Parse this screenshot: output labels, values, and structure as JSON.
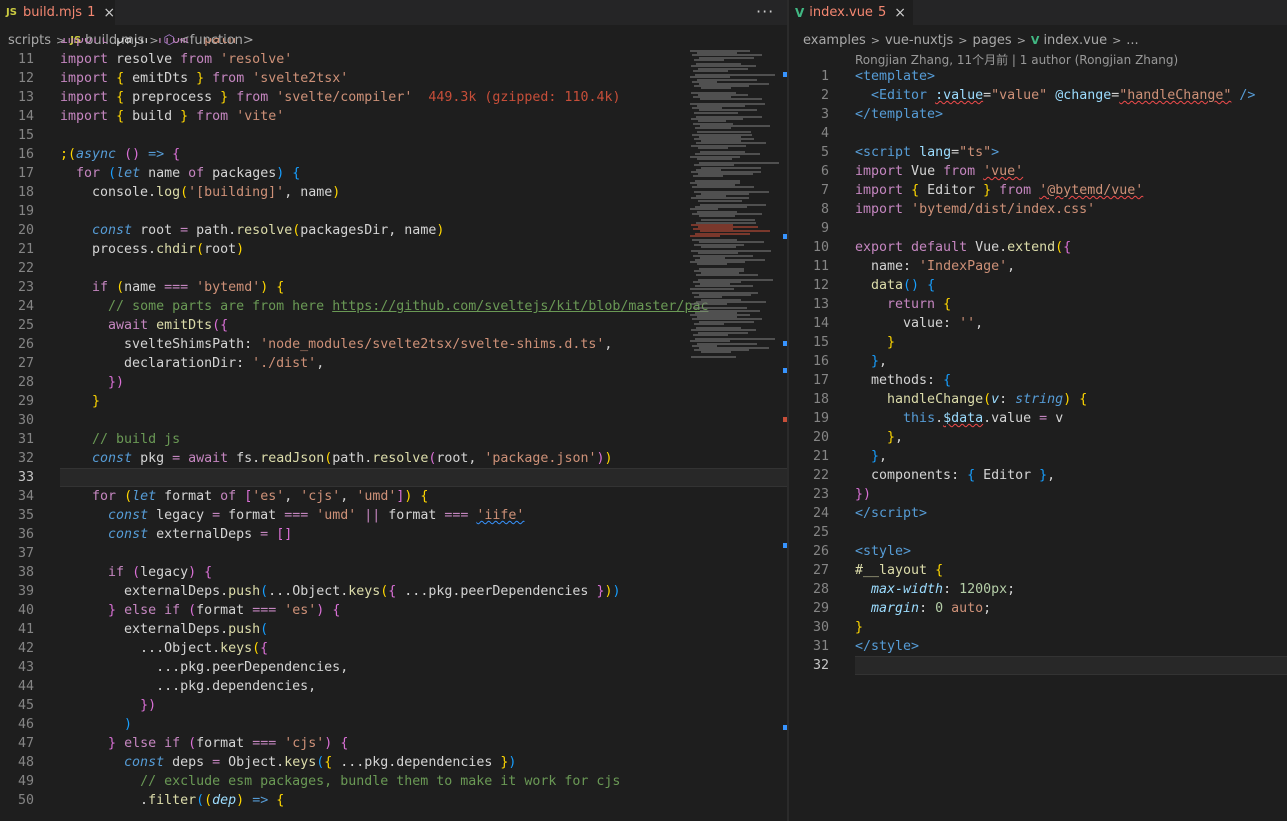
{
  "left": {
    "tab": {
      "lang_icon": "JS",
      "filename": "build.mjs",
      "problems": "1",
      "close": "×"
    },
    "more_actions": "···",
    "breadcrumb": [
      "scripts",
      "build.mjs",
      "<function>"
    ],
    "breadcrumb_icons": [
      "js-file-icon",
      "function-symbol-icon"
    ],
    "import_hint": "449.3k (gzipped: 110.4k)",
    "lines": [
      {
        "n": "11"
      },
      {
        "n": "12"
      },
      {
        "n": "13"
      },
      {
        "n": "14"
      },
      {
        "n": "15"
      },
      {
        "n": "16"
      },
      {
        "n": "17"
      },
      {
        "n": "18"
      },
      {
        "n": "19"
      },
      {
        "n": "20"
      },
      {
        "n": "21"
      },
      {
        "n": "22"
      },
      {
        "n": "23"
      },
      {
        "n": "24"
      },
      {
        "n": "25"
      },
      {
        "n": "26"
      },
      {
        "n": "27"
      },
      {
        "n": "28"
      },
      {
        "n": "29"
      },
      {
        "n": "30"
      },
      {
        "n": "31"
      },
      {
        "n": "32"
      },
      {
        "n": "33"
      },
      {
        "n": "34"
      },
      {
        "n": "35"
      },
      {
        "n": "36"
      },
      {
        "n": "37"
      },
      {
        "n": "38"
      },
      {
        "n": "39"
      },
      {
        "n": "40"
      },
      {
        "n": "41"
      },
      {
        "n": "42"
      },
      {
        "n": "43"
      },
      {
        "n": "44"
      },
      {
        "n": "45"
      },
      {
        "n": "46"
      },
      {
        "n": "47"
      },
      {
        "n": "48"
      },
      {
        "n": "49"
      },
      {
        "n": "50"
      }
    ],
    "link_text": "https://github.com/sveltejs/kit/blob/master/pac"
  },
  "right": {
    "tab": {
      "filename": "index.vue",
      "problems": "5",
      "close": "×"
    },
    "breadcrumb": [
      "examples",
      "vue-nuxtjs",
      "pages",
      "index.vue",
      "..."
    ],
    "codelens": "Rongjian Zhang, 11个月前 | 1 author (Rongjian Zhang)",
    "lines": [
      {
        "n": "1"
      },
      {
        "n": "2"
      },
      {
        "n": "3"
      },
      {
        "n": "4"
      },
      {
        "n": "5"
      },
      {
        "n": "6"
      },
      {
        "n": "7"
      },
      {
        "n": "8"
      },
      {
        "n": "9"
      },
      {
        "n": "10"
      },
      {
        "n": "11"
      },
      {
        "n": "12"
      },
      {
        "n": "13"
      },
      {
        "n": "14"
      },
      {
        "n": "15"
      },
      {
        "n": "16"
      },
      {
        "n": "17"
      },
      {
        "n": "18"
      },
      {
        "n": "19"
      },
      {
        "n": "20"
      },
      {
        "n": "21"
      },
      {
        "n": "22"
      },
      {
        "n": "23"
      },
      {
        "n": "24"
      },
      {
        "n": "25"
      },
      {
        "n": "26"
      },
      {
        "n": "27"
      },
      {
        "n": "28"
      },
      {
        "n": "29"
      },
      {
        "n": "30"
      },
      {
        "n": "31"
      },
      {
        "n": "32"
      }
    ]
  },
  "colors": {
    "editor_bg": "#1e1e1e",
    "tab_bar_bg": "#252526",
    "js_icon": "#cbcb41",
    "vue_icon": "#41b883",
    "error_tab_text": "#f48771",
    "current_line": "#282828"
  }
}
